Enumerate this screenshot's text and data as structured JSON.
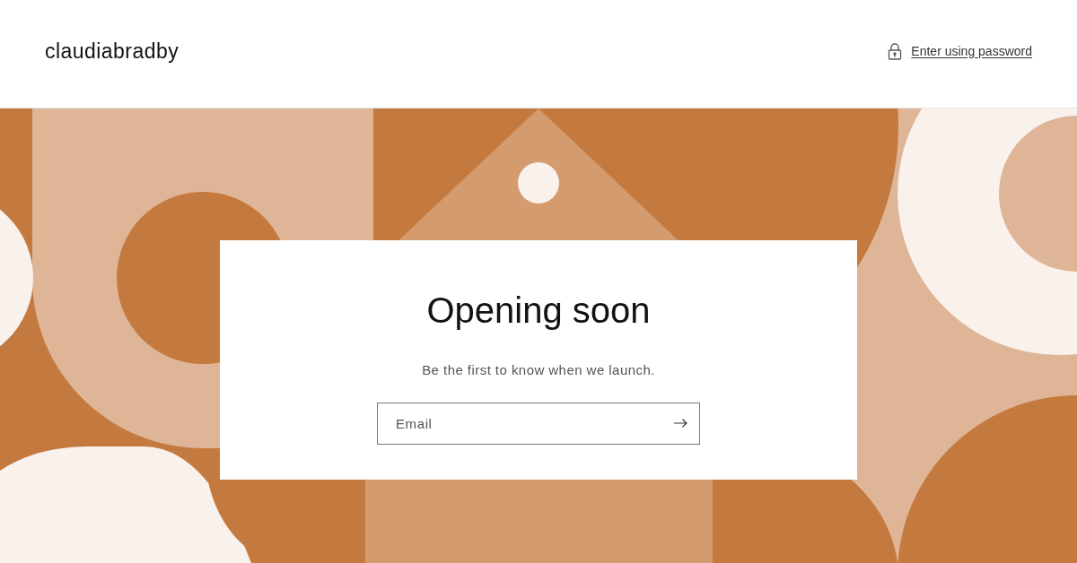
{
  "header": {
    "store_name": "claudiabradby",
    "password_link": "Enter using password"
  },
  "hero": {
    "heading": "Opening soon",
    "subtext": "Be the first to know when we launch.",
    "email_field": {
      "placeholder": "Email"
    }
  }
}
